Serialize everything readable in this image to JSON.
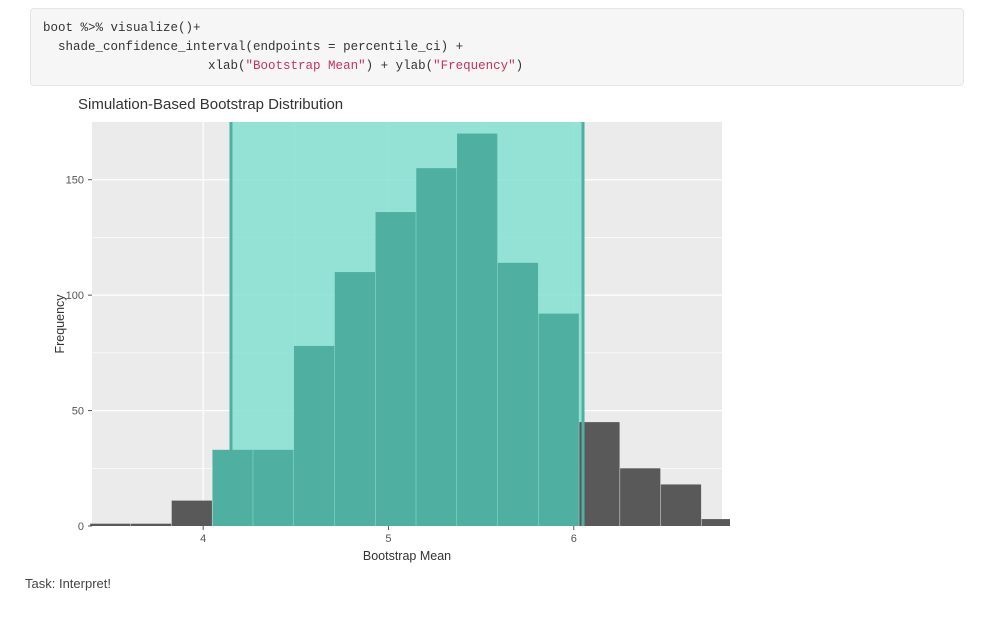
{
  "code": {
    "line1_a": "boot ",
    "line1_b": "%>%",
    "line1_c": " visualize()",
    "line1_d": "+",
    "line2_a": "  shade_confidence_interval(endpoints ",
    "line2_b": "=",
    "line2_c": " percentile_ci) ",
    "line2_d": "+",
    "line3_a": "                      xlab(",
    "line3_str1": "\"Bootstrap Mean\"",
    "line3_b": ") ",
    "line3_c": "+",
    "line3_d": " ylab(",
    "line3_str2": "\"Frequency\"",
    "line3_e": ")"
  },
  "chart_data": {
    "type": "bar",
    "title": "Simulation-Based Bootstrap Distribution",
    "xlabel": "Bootstrap Mean",
    "ylabel": "Frequency",
    "xlim": [
      3.4,
      6.8
    ],
    "ylim": [
      0,
      175
    ],
    "xticks": [
      4,
      5,
      6
    ],
    "yticks": [
      0,
      50,
      100,
      150
    ],
    "ci_low": 4.15,
    "ci_high": 6.05,
    "bin_width": 0.22,
    "bin_centers": [
      3.5,
      3.72,
      3.94,
      4.16,
      4.38,
      4.6,
      4.82,
      5.04,
      5.26,
      5.48,
      5.7,
      5.92,
      6.14,
      6.36,
      6.58
    ],
    "values": [
      1,
      1,
      11,
      33,
      33,
      78,
      110,
      136,
      155,
      170,
      114,
      92,
      45,
      25,
      18,
      3
    ],
    "bar_color_in": "#4fb0a1",
    "bar_color_out": "#595959",
    "ci_fill": "#85e0d2",
    "ci_line": "#4fb0a1",
    "panel_bg": "#ebebeb",
    "grid_color": "#ffffff"
  },
  "task": "Task: Interpret!"
}
